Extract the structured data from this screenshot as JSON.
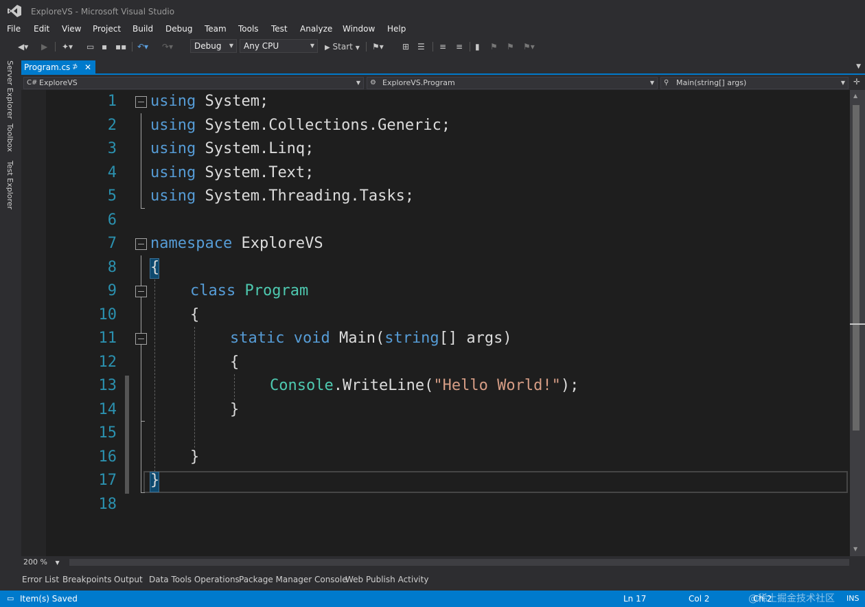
{
  "window": {
    "title": "ExploreVS - Microsoft Visual Studio"
  },
  "menu": [
    "File",
    "Edit",
    "View",
    "Project",
    "Build",
    "Debug",
    "Team",
    "Tools",
    "Test",
    "Analyze",
    "Window",
    "Help"
  ],
  "toolbar": {
    "config": "Debug",
    "platform": "Any CPU",
    "start_label": "Start"
  },
  "side_tabs": [
    "Server Explorer",
    "Toolbox",
    "Test Explorer"
  ],
  "document_tab": {
    "label": "Program.cs",
    "pin": "⊅",
    "close": "✕"
  },
  "navbar": {
    "project": "ExploreVS",
    "type": "ExploreVS.Program",
    "member": "Main(string[] args)"
  },
  "code": {
    "line_numbers": [
      "1",
      "2",
      "3",
      "4",
      "5",
      "6",
      "7",
      "8",
      "9",
      "10",
      "11",
      "12",
      "13",
      "14",
      "15",
      "16",
      "17",
      "18"
    ],
    "tokens": {
      "using": "using",
      "system": " System;",
      "system_collections": " System.Collections.Generic;",
      "system_linq": " System.Linq;",
      "system_text": " System.Text;",
      "system_threading": " System.Threading.Tasks;",
      "namespace": "namespace",
      "ns_name": " ExploreVS",
      "open_brace": "{",
      "close_brace": "}",
      "class": "class",
      "program": "Program",
      "static": "static",
      "void": "void",
      "main": " Main(",
      "string": "string",
      "args": "[] args)",
      "console": "Console",
      "writeline": ".WriteLine(",
      "hello": "\"Hello World!\"",
      "end_call": ");"
    }
  },
  "zoom": "200 %",
  "bottom_tabs": [
    "Error List",
    "Breakpoints",
    "Output",
    "Data Tools Operations",
    "Package Manager Console",
    "Web Publish Activity"
  ],
  "status": {
    "message": "Item(s) Saved",
    "line": "Ln 17",
    "col": "Col 2",
    "ch": "Ch 2",
    "mode": "INS",
    "watermark": "@稀土掘金技术社区"
  },
  "colors": {
    "accent": "#007acc",
    "keyword": "#569cd6",
    "type": "#4ec9b0",
    "string": "#d69d85",
    "line_number": "#2b91af"
  }
}
